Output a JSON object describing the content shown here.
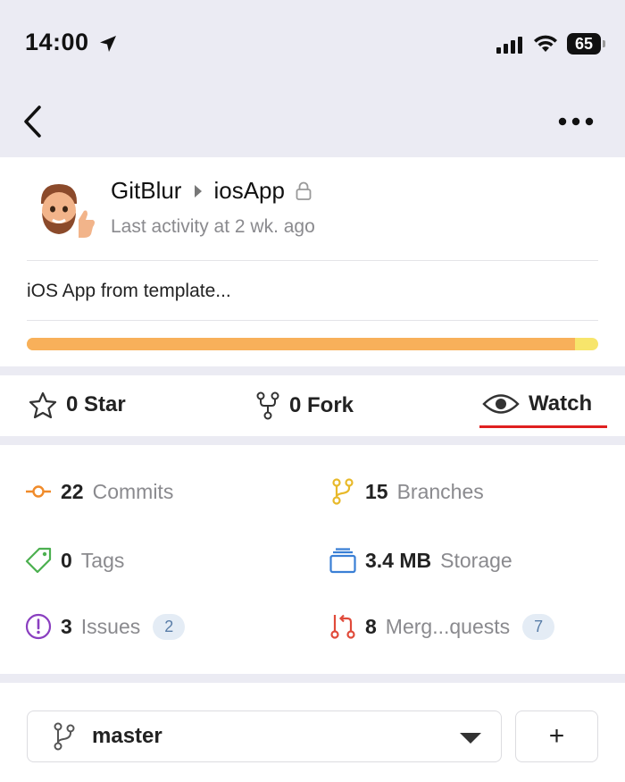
{
  "status_bar": {
    "time": "14:00",
    "battery": "65"
  },
  "repo": {
    "owner": "GitBlur",
    "name": "iosApp",
    "last_activity": "Last activity at 2 wk. ago",
    "description": "iOS App from template...",
    "language_bar": {
      "primary_fraction": 0.96,
      "primary_color": "#f8b05a",
      "secondary_color": "#f7e56b"
    }
  },
  "actions": {
    "star": "0 Star",
    "fork": "0 Fork",
    "watch": "Watch"
  },
  "stats": {
    "commits": {
      "count": "22",
      "label": "Commits"
    },
    "branches": {
      "count": "15",
      "label": "Branches"
    },
    "tags": {
      "count": "0",
      "label": "Tags"
    },
    "storage": {
      "count": "3.4 MB",
      "label": "Storage"
    },
    "issues": {
      "count": "3",
      "label": "Issues",
      "badge": "2"
    },
    "merge_requests": {
      "count": "8",
      "label": "Merg...quests",
      "badge": "7"
    }
  },
  "branch": {
    "selected": "master",
    "add_label": "+"
  },
  "colors": {
    "accent_red": "#e02020",
    "commit_orange": "#f08b2a",
    "branch_yellow": "#e8b92a",
    "tag_green": "#4cb050",
    "storage_blue": "#3a7fd5",
    "issue_purple": "#8a3fc0",
    "merge_red": "#e04a3a"
  }
}
